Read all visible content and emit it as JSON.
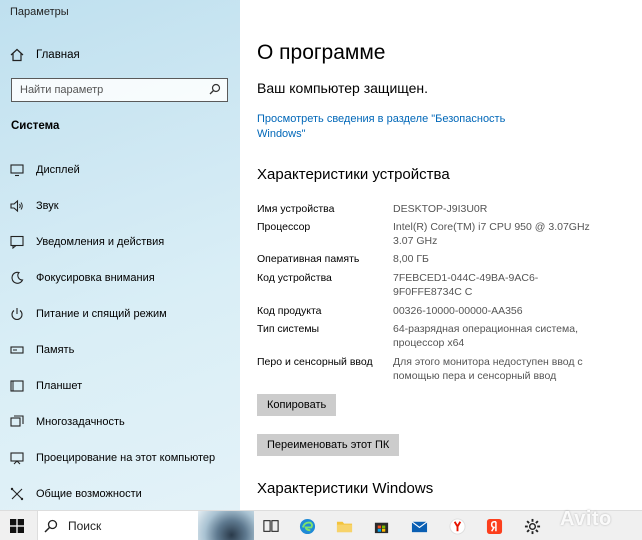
{
  "window": {
    "title": "Параметры"
  },
  "sidebar": {
    "home_label": "Главная",
    "search_placeholder": "Найти параметр",
    "section_title": "Система",
    "items": [
      {
        "label": "Дисплей",
        "icon": "display-icon"
      },
      {
        "label": "Звук",
        "icon": "sound-icon"
      },
      {
        "label": "Уведомления и действия",
        "icon": "notifications-icon"
      },
      {
        "label": "Фокусировка внимания",
        "icon": "focus-assist-icon"
      },
      {
        "label": "Питание и спящий режим",
        "icon": "power-icon"
      },
      {
        "label": "Память",
        "icon": "storage-icon"
      },
      {
        "label": "Планшет",
        "icon": "tablet-icon"
      },
      {
        "label": "Многозадачность",
        "icon": "multitasking-icon"
      },
      {
        "label": "Проецирование на этот компьютер",
        "icon": "projecting-icon"
      },
      {
        "label": "Общие возможности",
        "icon": "shared-experiences-icon"
      }
    ]
  },
  "main": {
    "title": "О программе",
    "protected_text": "Ваш компьютер защищен.",
    "security_link": "Просмотреть сведения в разделе \"Безопасность Windows\"",
    "device_specs_title": "Характеристики устройства",
    "specs": [
      {
        "key": "Имя устройства",
        "value": "DESKTOP-J9I3U0R"
      },
      {
        "key": "Процессор",
        "value": "Intel(R) Core(TM) i7 CPU        950  @ 3.07GHz   3.07 GHz"
      },
      {
        "key": "Оперативная память",
        "value": "8,00 ГБ"
      },
      {
        "key": "Код устройства",
        "value": "7FEBCED1-044C-49BA-9AC6-9F0FFE8734C C"
      },
      {
        "key": "Код продукта",
        "value": "00326-10000-00000-AA356"
      },
      {
        "key": "Тип системы",
        "value": "64-разрядная операционная система, процессор x64"
      },
      {
        "key": "Перо и сенсорный ввод",
        "value": "Для этого монитора недоступен ввод с помощью пера и сенсорный ввод"
      }
    ],
    "copy_button": "Копировать",
    "rename_button": "Переименовать этот ПК",
    "windows_specs_title": "Характеристики Windows"
  },
  "taskbar": {
    "search_label": "Поиск",
    "watermark": "Avito"
  },
  "colors": {
    "link": "#0067b8",
    "button_bg": "#cccccc",
    "sidebar_bg": "#cfe8f3"
  }
}
